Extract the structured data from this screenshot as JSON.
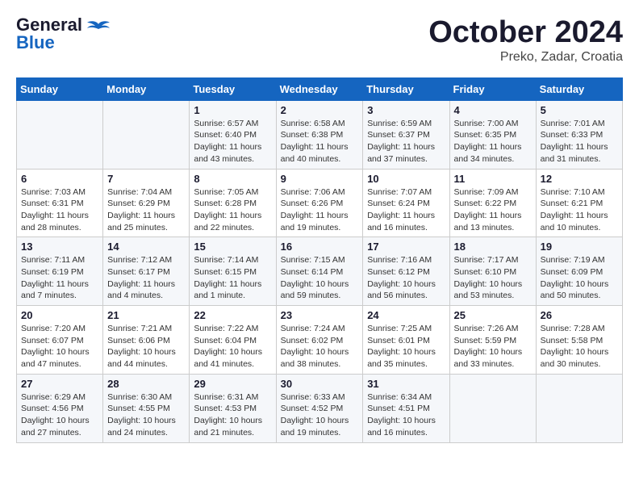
{
  "header": {
    "logo_line1": "General",
    "logo_line2": "Blue",
    "month": "October 2024",
    "location": "Preko, Zadar, Croatia"
  },
  "weekdays": [
    "Sunday",
    "Monday",
    "Tuesday",
    "Wednesday",
    "Thursday",
    "Friday",
    "Saturday"
  ],
  "weeks": [
    [
      {
        "day": "",
        "info": ""
      },
      {
        "day": "",
        "info": ""
      },
      {
        "day": "1",
        "info": "Sunrise: 6:57 AM\nSunset: 6:40 PM\nDaylight: 11 hours and 43 minutes."
      },
      {
        "day": "2",
        "info": "Sunrise: 6:58 AM\nSunset: 6:38 PM\nDaylight: 11 hours and 40 minutes."
      },
      {
        "day": "3",
        "info": "Sunrise: 6:59 AM\nSunset: 6:37 PM\nDaylight: 11 hours and 37 minutes."
      },
      {
        "day": "4",
        "info": "Sunrise: 7:00 AM\nSunset: 6:35 PM\nDaylight: 11 hours and 34 minutes."
      },
      {
        "day": "5",
        "info": "Sunrise: 7:01 AM\nSunset: 6:33 PM\nDaylight: 11 hours and 31 minutes."
      }
    ],
    [
      {
        "day": "6",
        "info": "Sunrise: 7:03 AM\nSunset: 6:31 PM\nDaylight: 11 hours and 28 minutes."
      },
      {
        "day": "7",
        "info": "Sunrise: 7:04 AM\nSunset: 6:29 PM\nDaylight: 11 hours and 25 minutes."
      },
      {
        "day": "8",
        "info": "Sunrise: 7:05 AM\nSunset: 6:28 PM\nDaylight: 11 hours and 22 minutes."
      },
      {
        "day": "9",
        "info": "Sunrise: 7:06 AM\nSunset: 6:26 PM\nDaylight: 11 hours and 19 minutes."
      },
      {
        "day": "10",
        "info": "Sunrise: 7:07 AM\nSunset: 6:24 PM\nDaylight: 11 hours and 16 minutes."
      },
      {
        "day": "11",
        "info": "Sunrise: 7:09 AM\nSunset: 6:22 PM\nDaylight: 11 hours and 13 minutes."
      },
      {
        "day": "12",
        "info": "Sunrise: 7:10 AM\nSunset: 6:21 PM\nDaylight: 11 hours and 10 minutes."
      }
    ],
    [
      {
        "day": "13",
        "info": "Sunrise: 7:11 AM\nSunset: 6:19 PM\nDaylight: 11 hours and 7 minutes."
      },
      {
        "day": "14",
        "info": "Sunrise: 7:12 AM\nSunset: 6:17 PM\nDaylight: 11 hours and 4 minutes."
      },
      {
        "day": "15",
        "info": "Sunrise: 7:14 AM\nSunset: 6:15 PM\nDaylight: 11 hours and 1 minute."
      },
      {
        "day": "16",
        "info": "Sunrise: 7:15 AM\nSunset: 6:14 PM\nDaylight: 10 hours and 59 minutes."
      },
      {
        "day": "17",
        "info": "Sunrise: 7:16 AM\nSunset: 6:12 PM\nDaylight: 10 hours and 56 minutes."
      },
      {
        "day": "18",
        "info": "Sunrise: 7:17 AM\nSunset: 6:10 PM\nDaylight: 10 hours and 53 minutes."
      },
      {
        "day": "19",
        "info": "Sunrise: 7:19 AM\nSunset: 6:09 PM\nDaylight: 10 hours and 50 minutes."
      }
    ],
    [
      {
        "day": "20",
        "info": "Sunrise: 7:20 AM\nSunset: 6:07 PM\nDaylight: 10 hours and 47 minutes."
      },
      {
        "day": "21",
        "info": "Sunrise: 7:21 AM\nSunset: 6:06 PM\nDaylight: 10 hours and 44 minutes."
      },
      {
        "day": "22",
        "info": "Sunrise: 7:22 AM\nSunset: 6:04 PM\nDaylight: 10 hours and 41 minutes."
      },
      {
        "day": "23",
        "info": "Sunrise: 7:24 AM\nSunset: 6:02 PM\nDaylight: 10 hours and 38 minutes."
      },
      {
        "day": "24",
        "info": "Sunrise: 7:25 AM\nSunset: 6:01 PM\nDaylight: 10 hours and 35 minutes."
      },
      {
        "day": "25",
        "info": "Sunrise: 7:26 AM\nSunset: 5:59 PM\nDaylight: 10 hours and 33 minutes."
      },
      {
        "day": "26",
        "info": "Sunrise: 7:28 AM\nSunset: 5:58 PM\nDaylight: 10 hours and 30 minutes."
      }
    ],
    [
      {
        "day": "27",
        "info": "Sunrise: 6:29 AM\nSunset: 4:56 PM\nDaylight: 10 hours and 27 minutes."
      },
      {
        "day": "28",
        "info": "Sunrise: 6:30 AM\nSunset: 4:55 PM\nDaylight: 10 hours and 24 minutes."
      },
      {
        "day": "29",
        "info": "Sunrise: 6:31 AM\nSunset: 4:53 PM\nDaylight: 10 hours and 21 minutes."
      },
      {
        "day": "30",
        "info": "Sunrise: 6:33 AM\nSunset: 4:52 PM\nDaylight: 10 hours and 19 minutes."
      },
      {
        "day": "31",
        "info": "Sunrise: 6:34 AM\nSunset: 4:51 PM\nDaylight: 10 hours and 16 minutes."
      },
      {
        "day": "",
        "info": ""
      },
      {
        "day": "",
        "info": ""
      }
    ]
  ]
}
